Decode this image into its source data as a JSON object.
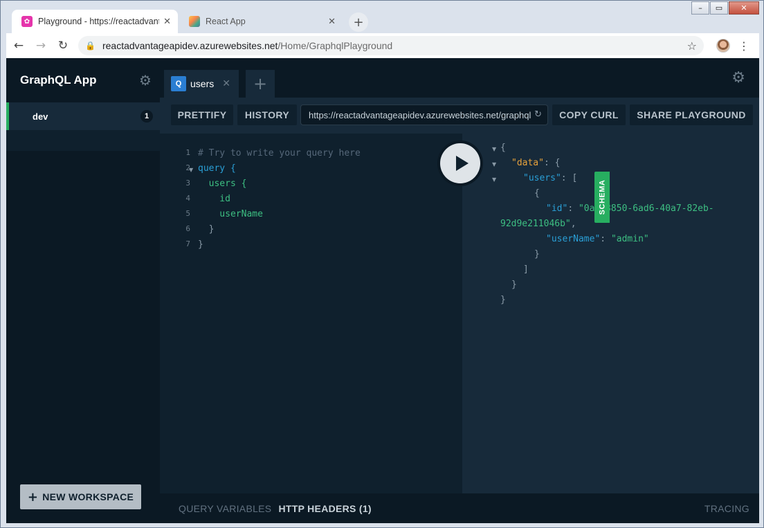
{
  "browser": {
    "tabs": [
      {
        "title": "Playground - https://reactadvant",
        "icon": "graphql-icon",
        "active": true
      },
      {
        "title": "React App",
        "icon": "react-app-icon",
        "active": false
      }
    ],
    "address": {
      "host": "reactadvantageapidev.azurewebsites.net",
      "path": "/Home/GraphqlPlayground"
    }
  },
  "sidebar": {
    "app_title": "GraphQL App",
    "environment": {
      "name": "dev",
      "count": "1"
    },
    "new_workspace_label": "NEW WORKSPACE"
  },
  "query_tab": {
    "badge": "Q",
    "name": "users"
  },
  "controls": {
    "prettify": "PRETTIFY",
    "history": "HISTORY",
    "endpoint": "https://reactadvantageapidev.azurewebsites.net/graphql",
    "copy_curl": "COPY CURL",
    "share": "SHARE PLAYGROUND"
  },
  "editor": {
    "lines": [
      {
        "n": "1",
        "text": "# Try to write your query here"
      },
      {
        "n": "2",
        "text": "query {"
      },
      {
        "n": "3",
        "text": "  users {"
      },
      {
        "n": "4",
        "text": "    id"
      },
      {
        "n": "5",
        "text": "    userName"
      },
      {
        "n": "6",
        "text": "  }"
      },
      {
        "n": "7",
        "text": "}"
      }
    ]
  },
  "result": {
    "data_key": "\"data\"",
    "users_key": "\"users\"",
    "id_key": "\"id\"",
    "id_value_part1": "\"0ad23850-6ad6-40a7-82eb-",
    "id_value_part2": "92d9e211046b\"",
    "username_key": "\"userName\"",
    "username_value": "\"admin\""
  },
  "schema_tab": "SCHEMA",
  "bottom": {
    "query_variables": "QUERY VARIABLES",
    "http_headers": "HTTP HEADERS (1)",
    "tracing": "TRACING"
  },
  "colors": {
    "accent_green": "#27ae60",
    "query_badge": "#2a7ed2",
    "background": "#0f202d"
  }
}
